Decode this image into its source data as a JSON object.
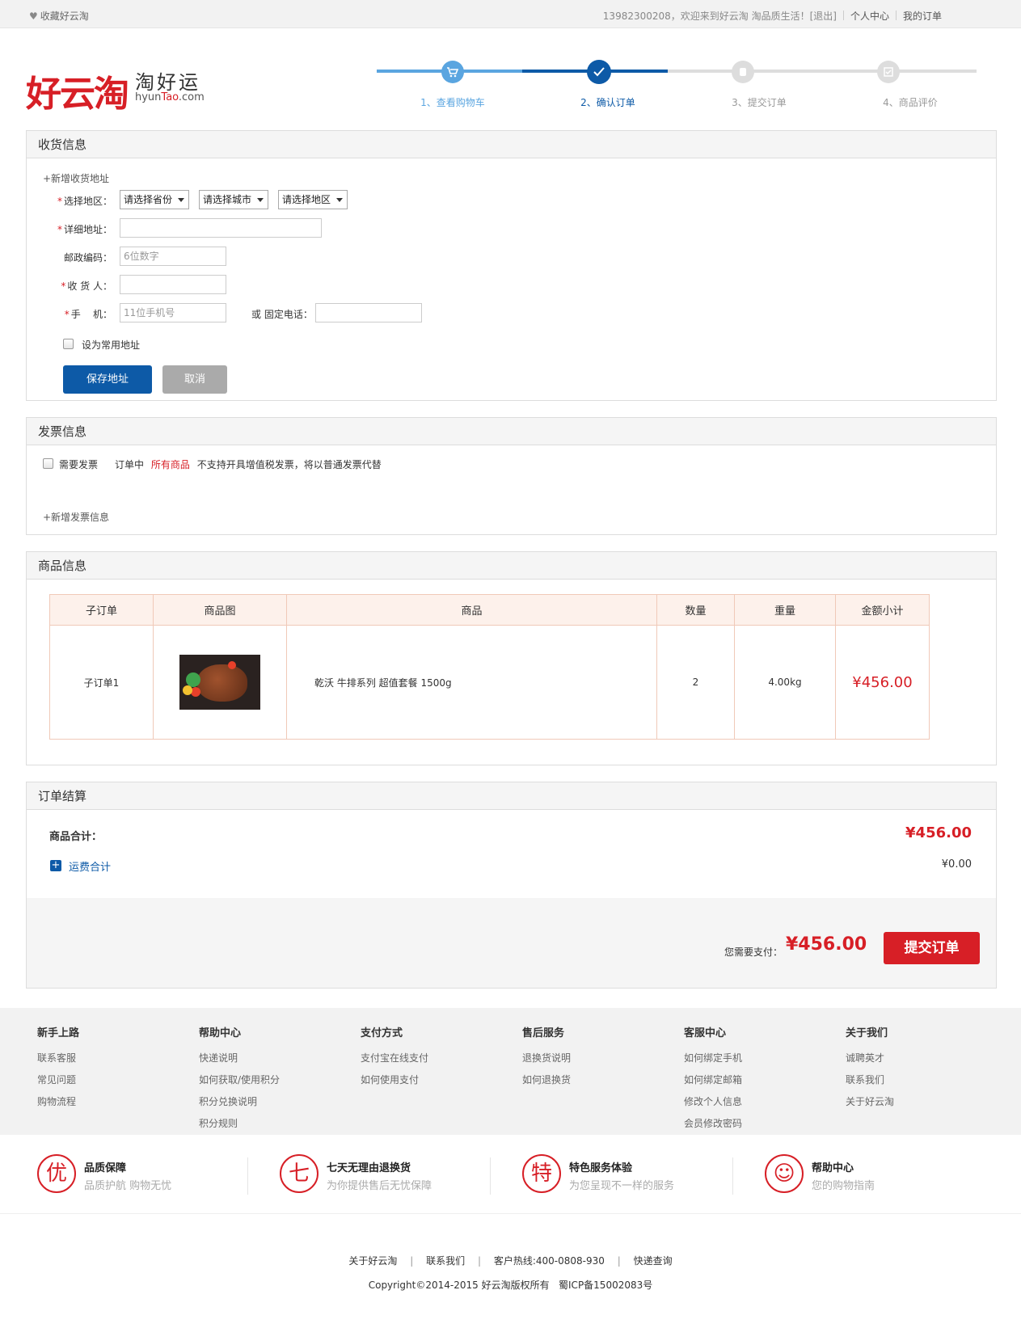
{
  "topbar": {
    "favorite": "收藏好云淘",
    "welcome": "13982300208，欢迎来到好云淘 淘品质生活！[退出]",
    "user_center": "个人中心",
    "my_orders": "我的订单"
  },
  "logo": {
    "main": "好云淘",
    "cn": "淘好运",
    "en_prefix": "hyun",
    "en_brand": "Tao",
    "en_suffix": ".com"
  },
  "steps": [
    {
      "label": "1、查看购物车",
      "icon": "cart-icon"
    },
    {
      "label": "2、确认订单",
      "icon": "check-icon"
    },
    {
      "label": "3、提交订单",
      "icon": "order-icon"
    },
    {
      "label": "4、商品评价",
      "icon": "review-icon"
    }
  ],
  "address": {
    "title": "收货信息",
    "add_new": "+新增收货地址",
    "region_label": "选择地区：",
    "province": "请选择省份",
    "city": "请选择城市",
    "district": "请选择地区",
    "detail_label": "详细地址：",
    "zip_label": "邮政编码：",
    "zip_placeholder": "6位数字",
    "receiver_label": "收 货 人：",
    "phone_label": "手    机：",
    "phone_placeholder": "11位手机号",
    "tel_label": "或 固定电话：",
    "default_label": "设为常用地址",
    "save": "保存地址",
    "cancel": "取消"
  },
  "invoice": {
    "title": "发票信息",
    "need": "需要发票",
    "note_prefix": "订单中",
    "note_highlight": "所有商品",
    "note_suffix": "不支持开具增值税发票，将以普通发票代替",
    "add_new": "+新增发票信息"
  },
  "goods": {
    "title": "商品信息",
    "headers": [
      "子订单",
      "商品图",
      "商品",
      "数量",
      "重量",
      "金额小计"
    ],
    "rows": [
      {
        "sub_order": "子订单1",
        "name": "乾沃 牛排系列 超值套餐 1500g",
        "qty": "2",
        "weight": "4.00kg",
        "amount": "¥456.00"
      }
    ]
  },
  "summary": {
    "title": "订单结算",
    "goods_total_label": "商品合计：",
    "goods_total": "¥456.00",
    "shipping_label": "运费合计",
    "shipping": "¥0.00",
    "pay_label": "您需要支付：",
    "pay_amount": "¥456.00",
    "submit": "提交订单"
  },
  "footer": {
    "columns": [
      {
        "title": "新手上路",
        "items": [
          "联系客服",
          "常见问题",
          "购物流程"
        ]
      },
      {
        "title": "帮助中心",
        "items": [
          "快递说明",
          "如何获取/使用积分",
          "积分兑换说明",
          "积分规则"
        ]
      },
      {
        "title": "支付方式",
        "items": [
          "支付宝在线支付",
          "如何使用支付"
        ]
      },
      {
        "title": "售后服务",
        "items": [
          "退换货说明",
          "如何退换货"
        ]
      },
      {
        "title": "客服中心",
        "items": [
          "如何绑定手机",
          "如何绑定邮箱",
          "修改个人信息",
          "会员修改密码"
        ]
      },
      {
        "title": "关于我们",
        "items": [
          "诚聘英才",
          "联系我们",
          "关于好云淘"
        ]
      }
    ],
    "promises": [
      {
        "glyph": "优",
        "title": "品质保障",
        "desc": "品质护航 购物无忧"
      },
      {
        "glyph": "七",
        "title": "七天无理由退换货",
        "desc": "为你提供售后无忧保障"
      },
      {
        "glyph": "特",
        "title": "特色服务体验",
        "desc": "为您呈现不一样的服务"
      },
      {
        "glyph": "☺",
        "title": "帮助中心",
        "desc": "您的购物指南"
      }
    ],
    "bottom_links": [
      "关于好云淘",
      "联系我们",
      "客户热线:400-0808-930",
      "快递查询"
    ],
    "copyright": "Copyright©2014-2015 好云淘版权所有   蜀ICP备15002083号"
  },
  "colors": {
    "brand_red": "#d71f26",
    "primary_blue": "#0d5aa7",
    "step_light_blue": "#5aa5e0",
    "price_red": "#d71f26"
  }
}
